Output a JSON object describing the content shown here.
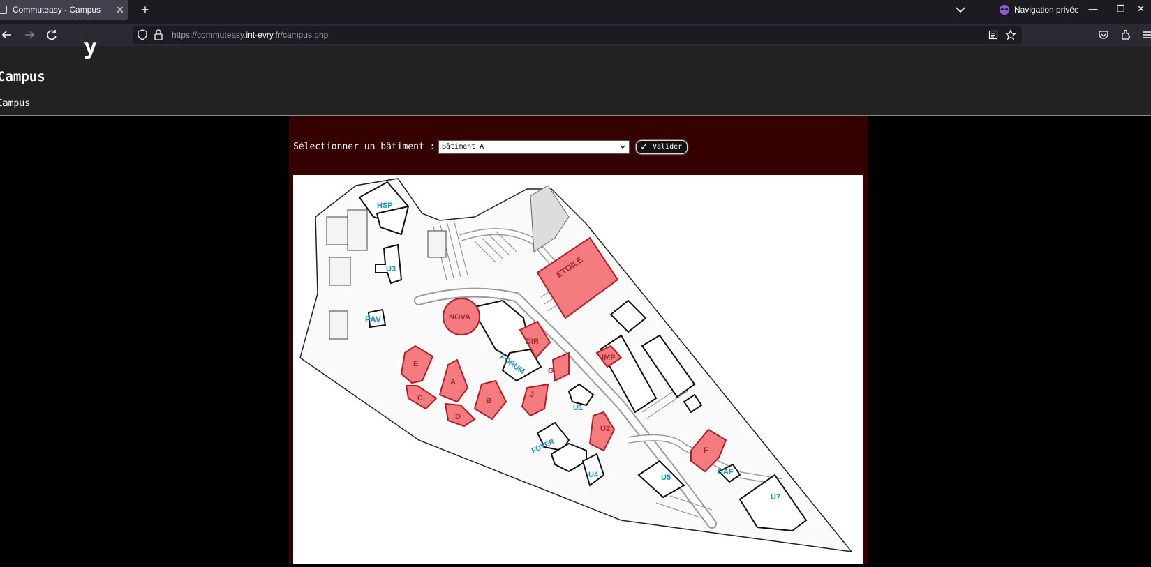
{
  "browser": {
    "tab_title": "Commuteasy - Campus",
    "tab_close": "✕",
    "new_tab": "+",
    "private_label": "Navigation privée",
    "url_prefix": "https://commuteasy.",
    "url_domain": "int-evry.fr",
    "url_path": "/campus.php",
    "minimize": "—",
    "restore": "❐",
    "close": "✕"
  },
  "page": {
    "cut_heading": "y",
    "title": "Campus",
    "breadcrumb": "Campus"
  },
  "form": {
    "label": "Sélectionner un bâtiment :",
    "selected": "Bâtiment A",
    "submit_label": "Valider",
    "submit_icon": "✓"
  },
  "map": {
    "buildings": {
      "hsp": "HSP",
      "u3": "U3",
      "pav": "PAV",
      "nova": "NOVA",
      "etoile": "ETOILE",
      "dir": "DIR",
      "imp": "IMP",
      "forum": "FORUM",
      "e": "E",
      "a": "A",
      "c": "C",
      "d": "D",
      "b": "B",
      "g": "G",
      "j": "J",
      "u1": "U1",
      "u2": "U2",
      "foyer": "FOYER",
      "u4": "U4",
      "u5": "U5",
      "f": "F",
      "daf": "DAF",
      "u7": "U7"
    },
    "highlight_color": "#f47c80",
    "label_color": "#1a8fc4"
  },
  "colors": {
    "content_bg": "#350000",
    "header_bg": "#222222",
    "tabbar_bg": "#1c1b22"
  }
}
